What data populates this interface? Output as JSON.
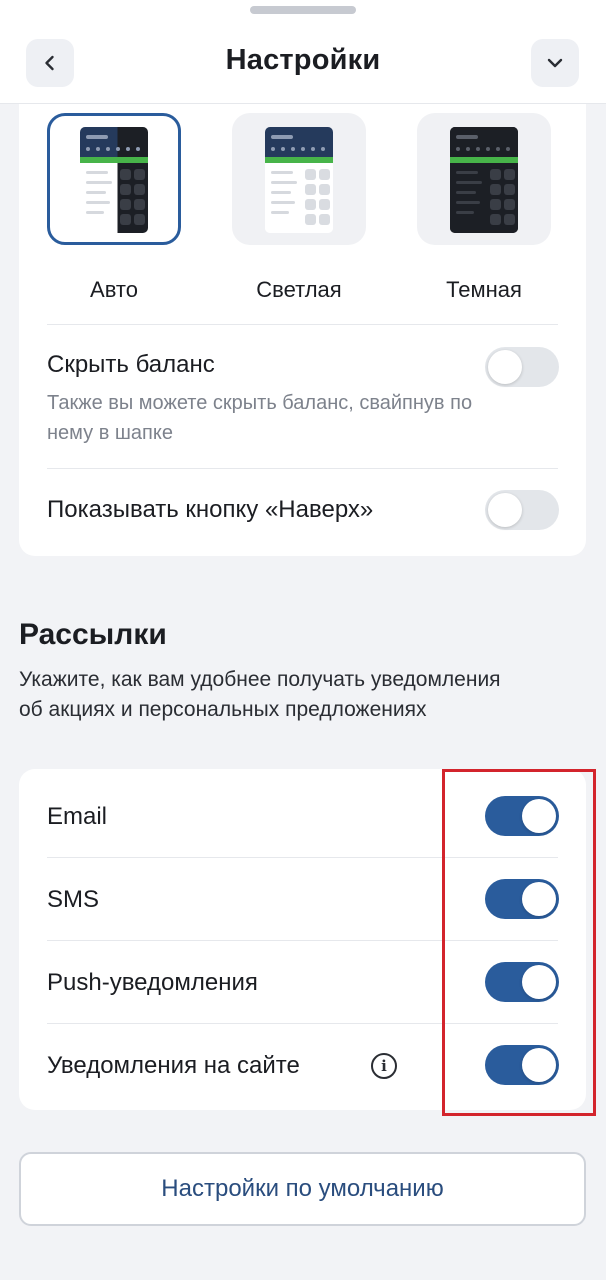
{
  "header": {
    "title": "Настройки",
    "back_icon": "chevron-left-icon",
    "collapse_icon": "chevron-down-icon"
  },
  "theme": {
    "options": [
      {
        "label": "Авто",
        "selected": true
      },
      {
        "label": "Светлая",
        "selected": false
      },
      {
        "label": "Темная",
        "selected": false
      }
    ]
  },
  "settings": {
    "hide_balance": {
      "title": "Скрыть баланс",
      "subtitle": "Также вы можете скрыть баланс, свайпнув по нему в шапке",
      "enabled": false
    },
    "scroll_top": {
      "title": "Показывать кнопку «Наверх»",
      "enabled": false
    }
  },
  "mailings": {
    "title": "Рассылки",
    "description": "Укажите, как вам удобнее получать уведомления об акциях и персональных предложениях",
    "items": [
      {
        "label": "Email",
        "enabled": true
      },
      {
        "label": "SMS",
        "enabled": true
      },
      {
        "label": "Push-уведомления",
        "enabled": true
      },
      {
        "label": "Уведомления на сайте",
        "enabled": true,
        "info_icon": "info-icon"
      }
    ]
  },
  "reset_button": {
    "label": "Настройки по умолчанию"
  },
  "colors": {
    "accent": "#2a5c9c",
    "highlight": "#d3242c",
    "toggle_off": "#e3e6ea",
    "background": "#f2f3f6"
  }
}
